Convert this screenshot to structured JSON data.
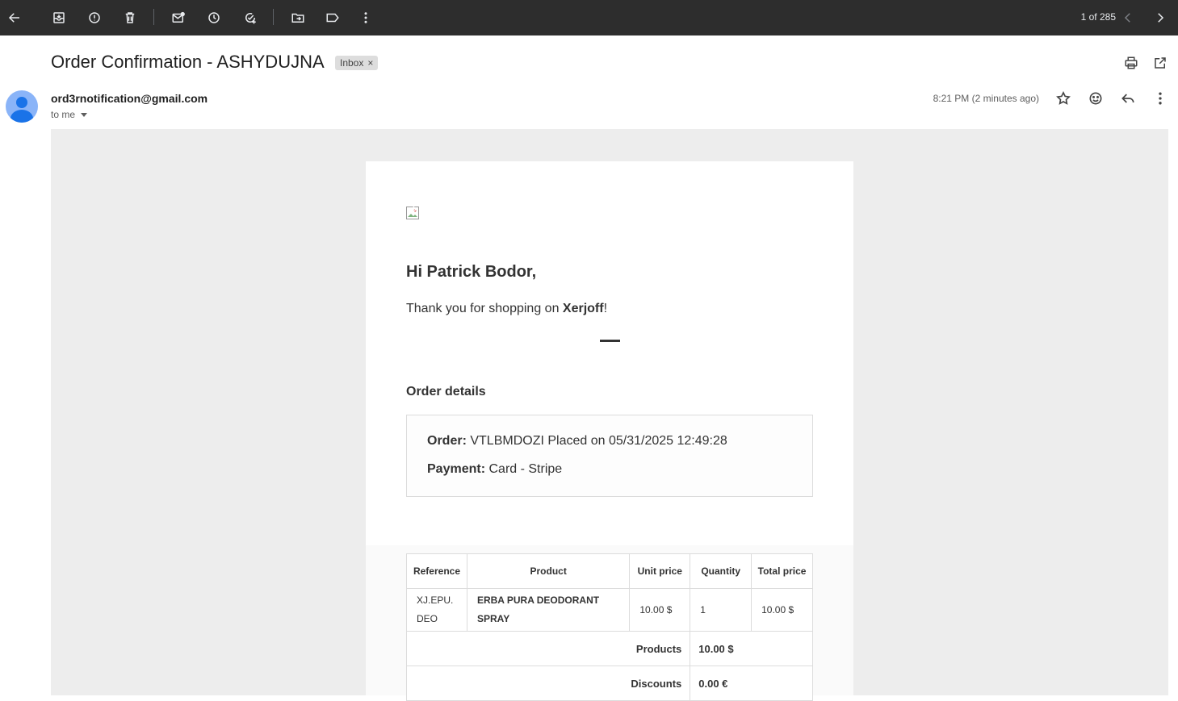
{
  "toolbar": {
    "pager": "1 of 285"
  },
  "message": {
    "subject": "Order Confirmation - ASHYDUJNA",
    "label": "Inbox",
    "label_remove": "×",
    "sender": "ord3rnotification@gmail.com",
    "recipient": "to me",
    "timestamp": "8:21 PM (2 minutes ago)"
  },
  "email": {
    "greeting": "Hi Patrick Bodor,",
    "thanks_prefix": "Thank you for shopping on ",
    "shop_name": "Xerjoff",
    "thanks_suffix": "!",
    "order_details_title": "Order details",
    "order_label": "Order:",
    "order_value": "VTLBMDOZI Placed on 05/31/2025 12:49:28",
    "payment_label": "Payment:",
    "payment_value": "Card - Stripe",
    "table": {
      "headers": [
        "Reference",
        "Product",
        "Unit price",
        "Quantity",
        "Total price"
      ],
      "rows": [
        {
          "reference_1": "XJ.EPU.",
          "reference_2": "DEO",
          "product_1": "ERBA PURA DEODORANT",
          "product_2": "SPRAY",
          "unit_price": "10.00 $",
          "quantity": "1",
          "total_price": "10.00 $"
        }
      ],
      "summary": [
        {
          "label": "Products",
          "value": "10.00 $"
        },
        {
          "label": "Discounts",
          "value": "0.00 €"
        }
      ]
    }
  }
}
